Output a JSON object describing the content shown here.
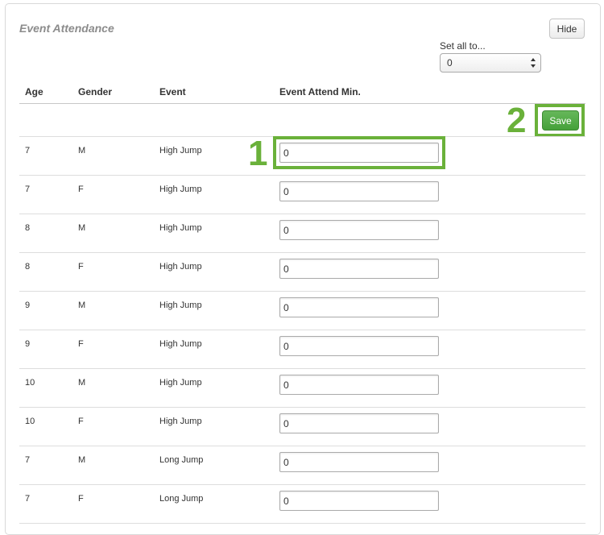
{
  "panel": {
    "title": "Event Attendance",
    "hide_label": "Hide",
    "set_all_label": "Set all to...",
    "set_all_value": "0",
    "save_label": "Save"
  },
  "table": {
    "headers": [
      "Age",
      "Gender",
      "Event",
      "Event Attend Min."
    ],
    "rows": [
      {
        "age": "7",
        "gender": "M",
        "event": "High Jump",
        "attend_min": "0"
      },
      {
        "age": "7",
        "gender": "F",
        "event": "High Jump",
        "attend_min": "0"
      },
      {
        "age": "8",
        "gender": "M",
        "event": "High Jump",
        "attend_min": "0"
      },
      {
        "age": "8",
        "gender": "F",
        "event": "High Jump",
        "attend_min": "0"
      },
      {
        "age": "9",
        "gender": "M",
        "event": "High Jump",
        "attend_min": "0"
      },
      {
        "age": "9",
        "gender": "F",
        "event": "High Jump",
        "attend_min": "0"
      },
      {
        "age": "10",
        "gender": "M",
        "event": "High Jump",
        "attend_min": "0"
      },
      {
        "age": "10",
        "gender": "F",
        "event": "High Jump",
        "attend_min": "0"
      },
      {
        "age": "7",
        "gender": "M",
        "event": "Long Jump",
        "attend_min": "0"
      },
      {
        "age": "7",
        "gender": "F",
        "event": "Long Jump",
        "attend_min": "0"
      }
    ]
  },
  "callouts": [
    "1",
    "2"
  ],
  "colors": {
    "accent_green": "#6ab13a",
    "save_button": "#45a13a",
    "title_gray": "#8c8c8c"
  },
  "icons": {
    "select_arrows": "select-arrows-icon"
  }
}
